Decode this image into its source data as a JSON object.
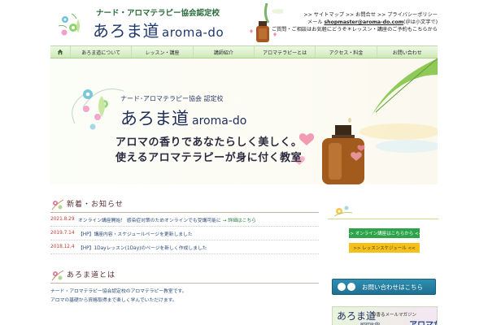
{
  "header": {
    "logo_sub": "ナード・アロマテラピー協会認定校",
    "logo_main": "あろま道",
    "logo_roman": "aroma-do",
    "breadcrumb": ">> サイトマップ >> お問合せ >> プライバシーポリシー",
    "mail_prefix": "メール",
    "mail": "shopmaster@aroma-do.com",
    "mail_suffix": "(＠は小文字で)",
    "contact_note": "ご質問・ご相談はお気軽にどうぞ＊レッスン・講座のご予約もこちらから"
  },
  "nav": {
    "home_icon": "home-icon",
    "items": [
      {
        "label": "あろま道について"
      },
      {
        "label": "レッスン・講座"
      },
      {
        "label": "講師紹介"
      },
      {
        "label": "アロマテラピーとは"
      },
      {
        "label": "アクセス・料金"
      },
      {
        "label": "お問い合わせ"
      }
    ]
  },
  "hero": {
    "sub": "ナード･アロマテラピー協会 認定校",
    "title": "あろま道",
    "title_roman": "aroma-do",
    "catch_line1": "アロマの香りであなたらしく美しく。",
    "catch_line2": "使えるアロマテラピーが身に付く教室"
  },
  "news": {
    "title": "新着・お知らせ",
    "items": [
      {
        "date": "2021.8.29",
        "text": "オンライン講座開始！ 感染症対策のためオンラインでも受講可能に",
        "new": "→ 詳細はこちら"
      },
      {
        "date": "2019.7.14",
        "text": "【HP】講座内容・スケジュールページを更新しました",
        "new": ""
      },
      {
        "date": "2018.12.4",
        "text": "【HP】1Dayレッスン(1Day)のページを新しく作成しました",
        "new": ""
      }
    ]
  },
  "info": {
    "title": "あろま道とは",
    "lines": [
      "ナード・アロマテラピー協会認定校のアロマテラピー教室です。",
      "アロマの基礎から資格取得まで楽しく学んでいただけます。"
    ]
  },
  "side": {
    "green_button": ">> オンライン講座はこちらから <<",
    "yellow_button": ">> レッスンスケジュール <<",
    "contact_button": "お問い合わせはこちら",
    "mag_title": "あろま道",
    "mag_roman": "aroma-do",
    "mag_sub": "の香るメールマガジン",
    "mag_big": "アロマだ"
  },
  "colors": {
    "nav_green": "#cfe9b8",
    "btn_green": "#2ea44a",
    "btn_yellow": "#f3c11a",
    "btn_contact": "#1f6f92",
    "news_date": "#c0392b",
    "link": "#2b4b7a"
  }
}
